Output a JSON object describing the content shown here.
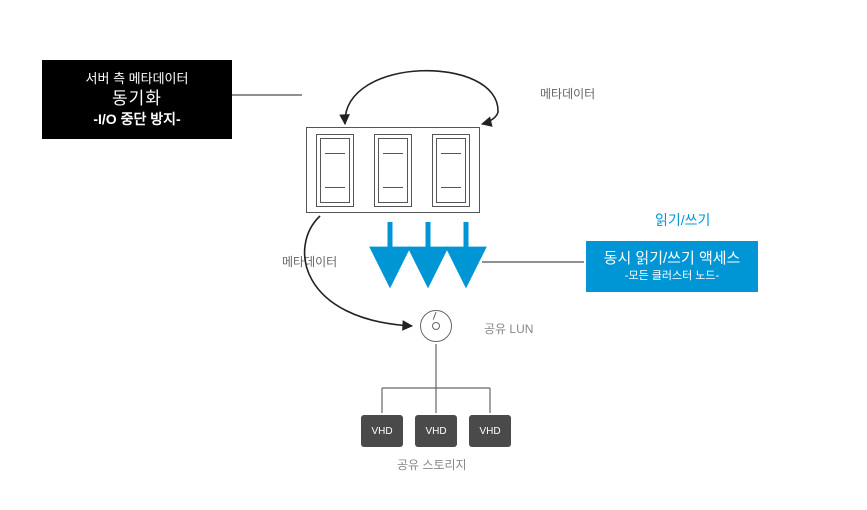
{
  "callouts": {
    "serverMetadata": {
      "line1": "서버 측 메타데이터",
      "line2": "동기화",
      "line3": "-I/O 중단 방지-"
    },
    "concurrentAccess": {
      "line1": "동시 읽기/쓰기 액세스",
      "line2": "-모든 클러스터 노드-"
    }
  },
  "labels": {
    "metadataTop": "메타데이터",
    "metadataLeft": "메타데이터",
    "readWrite": "읽기/쓰기",
    "sharedLun": "공유 LUN",
    "sharedStorage": "공유 스토리지"
  },
  "vhd": [
    "VHD",
    "VHD",
    "VHD"
  ],
  "colors": {
    "blue": "#0096d6",
    "black": "#000000",
    "stroke": "#333333"
  }
}
